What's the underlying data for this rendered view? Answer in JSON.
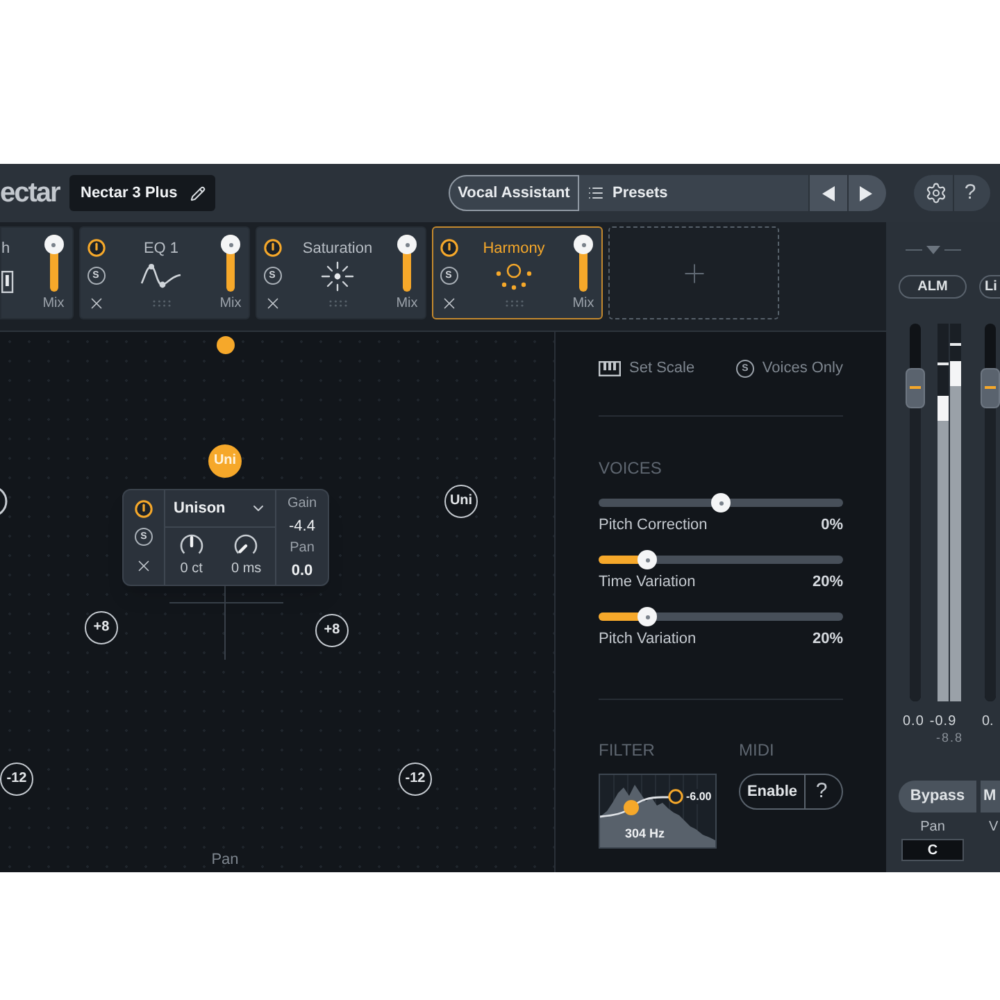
{
  "header": {
    "logo": "ectar",
    "preset_name": "Nectar 3 Plus",
    "assistant_button": "Vocal Assistant",
    "presets_button": "Presets",
    "help_button": "?"
  },
  "modules": [
    {
      "kind": "partial",
      "title": "h",
      "mix_label": "Mix",
      "level": 1,
      "selected": false
    },
    {
      "kind": "eq",
      "title": "EQ 1",
      "on": true,
      "solo": "S",
      "mix_label": "Mix",
      "level": 1,
      "selected": false
    },
    {
      "kind": "saturation",
      "title": "Saturation",
      "on": true,
      "solo": "S",
      "mix_label": "Mix",
      "level": 1,
      "selected": false
    },
    {
      "kind": "harmony",
      "title": "Harmony",
      "on": true,
      "solo": "S",
      "mix_label": "Mix",
      "level": 1,
      "selected": true
    }
  ],
  "canvas": {
    "nodes": [
      {
        "label": "Uni",
        "selected": true
      },
      {
        "label": "Uni",
        "selected": false
      },
      {
        "label": "+8",
        "selected": false
      },
      {
        "label": "+8",
        "selected": false
      },
      {
        "label": "-12",
        "selected": false
      },
      {
        "label": "-12",
        "selected": false
      }
    ],
    "popup": {
      "on": true,
      "solo": "S",
      "voice_type": "Unison",
      "knobs": [
        {
          "kind": "bipolar",
          "value": "0 ct"
        },
        {
          "kind": "unipolar",
          "value": "0 ms"
        }
      ],
      "gain_label": "Gain",
      "gain": "-4.4",
      "pan_label": "Pan",
      "pan": "0.0"
    },
    "axis_label": "Pan"
  },
  "side_panel": {
    "set_scale": "Set Scale",
    "voices_only": {
      "solo": "S",
      "label": "Voices Only",
      "on": false
    },
    "voices_heading": "VOICES",
    "sliders": [
      {
        "kind": "bipolar",
        "label": "Pitch Correction",
        "value": "0%",
        "level": 0.5
      },
      {
        "kind": "unipolar",
        "label": "Time Variation",
        "value": "20%",
        "level": 0.2
      },
      {
        "kind": "unipolar",
        "label": "Pitch Variation",
        "value": "20%",
        "level": 0.2
      }
    ],
    "filter": {
      "heading": "FILTER",
      "gain": "-6.00",
      "frequency": "304 Hz"
    },
    "midi": {
      "heading": "MIDI",
      "enable": "Enable",
      "help": "?"
    }
  },
  "output": {
    "channels": [
      {
        "mode_button": "ALM",
        "fader": {
          "level": 0.83
        },
        "meters": [
          {
            "level": 0.81,
            "hold": {
              "level": 0.89
            }
          },
          {
            "level": 0.9,
            "hold": {
              "level": 0.94
            }
          }
        ],
        "readings": [
          "0.0",
          "-0.9"
        ],
        "peak_reading": "-8.8"
      },
      {
        "mode_button": "Li",
        "fader": {
          "level": 0.83
        },
        "readings": [
          "0."
        ]
      }
    ],
    "buttons": [
      {
        "label": "Bypass"
      },
      {
        "label": "M"
      }
    ],
    "controls": [
      {
        "label": "Pan",
        "value": "C"
      },
      {
        "label": "V"
      }
    ]
  }
}
